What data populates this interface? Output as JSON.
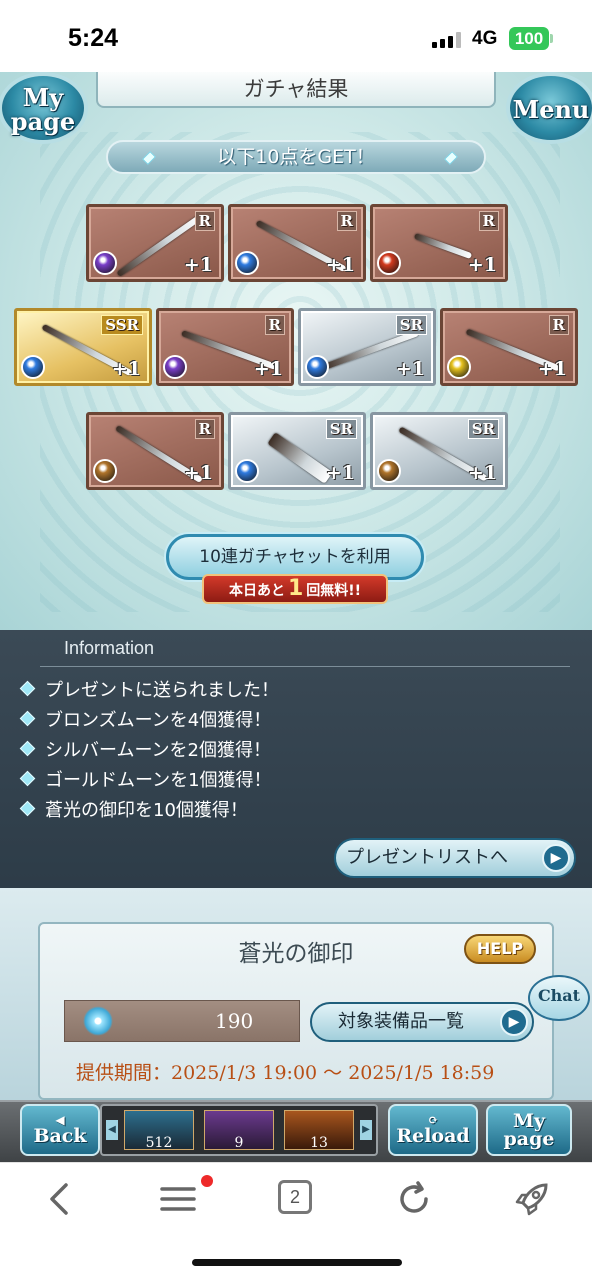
{
  "status": {
    "time": "5:24",
    "network": "4G",
    "battery": "100"
  },
  "header": {
    "title": "ガチャ結果",
    "mypage": "My page",
    "menu": "Menu"
  },
  "get_banner": "以下10点をGET！",
  "items": [
    {
      "rarity": "R",
      "element": "dark",
      "plus": "+1"
    },
    {
      "rarity": "R",
      "element": "water",
      "plus": "+1"
    },
    {
      "rarity": "R",
      "element": "fire",
      "plus": "+1"
    },
    {
      "rarity": "SSR",
      "element": "water",
      "plus": "+1"
    },
    {
      "rarity": "R",
      "element": "dark",
      "plus": "+1"
    },
    {
      "rarity": "SR",
      "element": "water",
      "plus": "+1"
    },
    {
      "rarity": "R",
      "element": "light",
      "plus": "+1"
    },
    {
      "rarity": "R",
      "element": "earth",
      "plus": "+1"
    },
    {
      "rarity": "SR",
      "element": "water",
      "plus": "+1"
    },
    {
      "rarity": "SR",
      "element": "earth",
      "plus": "+1"
    }
  ],
  "gacha_button": "10連ガチャセットを利用",
  "free_label": {
    "prefix": "本日あと",
    "count": "1",
    "suffix": "回無料!!"
  },
  "information": {
    "title": "Information",
    "lines": [
      "プレゼントに送られました！",
      "ブロンズムーンを4個獲得！",
      "シルバームーンを2個獲得！",
      "ゴールドムーンを1個獲得！",
      "蒼光の御印を10個獲得！"
    ],
    "present_button": "プレゼントリストへ"
  },
  "seal": {
    "title": "蒼光の御印",
    "help": "HELP",
    "count": "190",
    "equip_button": "対象装備品一覧",
    "period": "提供期間：2025/1/3 19:00 〜 2025/1/5 18:59"
  },
  "chat": "Chat",
  "game_bar": {
    "back": "Back",
    "reload": "Reload",
    "mypage": "My page",
    "moons": [
      "512",
      "9",
      "13"
    ]
  },
  "browser": {
    "tabs": "2"
  },
  "colors": {
    "water": "#2f7be0",
    "dark": "#7a3fc9",
    "fire": "#d23a1f",
    "light": "#e6c21e",
    "earth": "#b0742a"
  }
}
